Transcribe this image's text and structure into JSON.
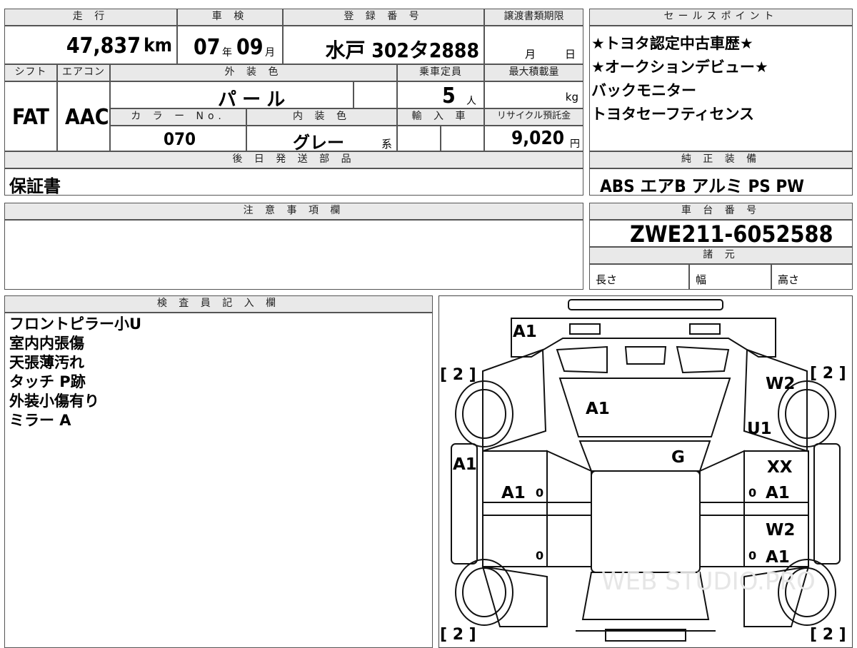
{
  "header": {
    "mileage_label": "走 行",
    "mileage_value": "47,837",
    "mileage_unit": "km",
    "inspection_label": "車 検",
    "inspection_year": "07",
    "inspection_year_unit": "年",
    "inspection_month": "09",
    "inspection_month_unit": "月",
    "registration_label": "登 録 番 号",
    "registration_value": "水戸 302タ2888",
    "transfer_label": "譲渡書類期限",
    "transfer_month": "月",
    "transfer_day": "日"
  },
  "row2": {
    "shift_label": "シフト",
    "shift_value": "FAT",
    "ac_label": "エアコン",
    "ac_value": "AAC",
    "exterior_label": "外 装 色",
    "exterior_value": "パ ー ル",
    "capacity_label": "乗車定員",
    "capacity_value": "5",
    "capacity_unit": "人",
    "max_load_label": "最大積載量",
    "max_load_unit": "kg",
    "color_no_label": "カ ラ ー No.",
    "color_no_value": "070",
    "interior_label": "内 装 色",
    "interior_value": "グレー",
    "interior_suffix": "系",
    "import_label": "輸 入 車",
    "recycle_label": "リサイクル預託金",
    "recycle_value": "9,020",
    "recycle_unit": "円"
  },
  "later_parts": {
    "label": "後 日 発 送 部 品",
    "value": "保証書"
  },
  "sales_points": {
    "label": "セールスポイント",
    "items": [
      "★トヨタ認定中古車歴★",
      "★オークションデビュー★",
      "バックモニター",
      "トヨタセーフティセンス"
    ]
  },
  "equipment": {
    "label": "純 正 装 備",
    "value": "ABS エアB アルミ PS PW"
  },
  "notes": {
    "label": "注 意 事 項 欄"
  },
  "chassis": {
    "label": "車 台 番 号",
    "value": "ZWE211-6052588",
    "specs_label": "諸 元",
    "length_label": "長さ",
    "width_label": "幅",
    "height_label": "高さ"
  },
  "inspector": {
    "label": "検 査 員 記 入 欄",
    "lines": [
      "フロントピラー小U",
      "室内内張傷",
      "天張薄汚れ",
      "タッチ P跡",
      "外装小傷有り",
      "ミラー A"
    ]
  },
  "diagram": {
    "marks": [
      "A1",
      "A1",
      "W2",
      "U1",
      "G",
      "A1",
      "XX",
      "A1",
      "A1",
      "W2",
      "A1"
    ],
    "tire_grades": [
      "[ 2 ]",
      "[ 2 ]",
      "[ 2 ]",
      "[ 2 ]"
    ],
    "zeros": [
      "0",
      "0",
      "0",
      "0"
    ],
    "watermark": "WEB STUDIO.PRO"
  }
}
